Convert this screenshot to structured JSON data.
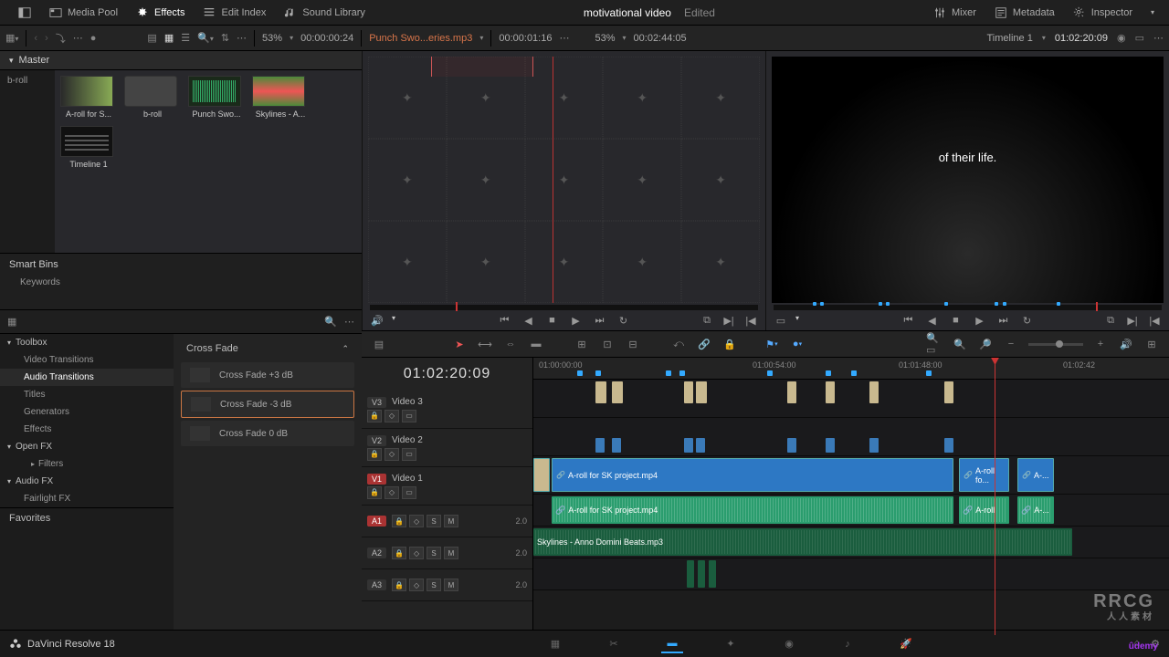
{
  "topbar": {
    "media_pool": "Media Pool",
    "effects": "Effects",
    "edit_index": "Edit Index",
    "sound_library": "Sound Library",
    "mixer": "Mixer",
    "metadata": "Metadata",
    "inspector": "Inspector"
  },
  "project": {
    "title": "motivational video",
    "status": "Edited"
  },
  "toolbar": {
    "src_zoom": "53%",
    "src_tc": "00:00:00:24",
    "src_clip": "Punch Swo...eries.mp3",
    "src_dur": "00:00:01:16",
    "rec_zoom": "53%",
    "rec_tc": "00:02:44:05",
    "timeline_sel": "Timeline 1",
    "rec_pos": "01:02:20:09"
  },
  "bins": {
    "master": "Master",
    "broll": "b-roll"
  },
  "media": [
    {
      "label": "A-roll for S...",
      "type": "video1"
    },
    {
      "label": "b-roll",
      "type": "folder"
    },
    {
      "label": "Punch Swo...",
      "type": "audio"
    },
    {
      "label": "Skylines - A...",
      "type": "sky"
    },
    {
      "label": "Timeline 1",
      "type": "tl"
    }
  ],
  "smart_bins": {
    "header": "Smart Bins",
    "keywords": "Keywords"
  },
  "fx_tree": {
    "toolbox": "Toolbox",
    "video_transitions": "Video Transitions",
    "audio_transitions": "Audio Transitions",
    "titles": "Titles",
    "generators": "Generators",
    "effects": "Effects",
    "openfx": "Open FX",
    "filters": "Filters",
    "audiofx": "Audio FX",
    "fairlight": "Fairlight FX"
  },
  "fx_list": {
    "header": "Cross Fade",
    "item1": "Cross Fade +3 dB",
    "item2": "Cross Fade -3 dB",
    "item3": "Cross Fade 0 dB"
  },
  "favorites": "Favorites",
  "viewer": {
    "caption": "of their life."
  },
  "timeline": {
    "tc": "01:02:20:09",
    "v3": {
      "badge": "V3",
      "label": "Video 3"
    },
    "v2": {
      "badge": "V2",
      "label": "Video 2"
    },
    "v1": {
      "badge": "V1",
      "label": "Video 1"
    },
    "a1": {
      "badge": "A1"
    },
    "a2": {
      "badge": "A2"
    },
    "a3": {
      "badge": "A3"
    },
    "audio_level": "2.0",
    "ruler": [
      "01:00:00:00",
      "01:00:54:00",
      "01:01:48:00",
      "01:02:42"
    ],
    "clip_v1a": "A-roll for SK project.mp4",
    "clip_v1b": "A-roll fo...",
    "clip_v1c": "A-...",
    "clip_a1a": "A-roll for SK project.mp4",
    "clip_a1b": "A-roll",
    "clip_a1c": "A-...",
    "clip_a2": "Skylines - Anno Domini Beats.mp3"
  },
  "bottom": {
    "app": "DaVinci Resolve 18"
  },
  "watermark": {
    "main": "RRCG",
    "sub": "人人素材"
  },
  "brand": "ûdemy"
}
